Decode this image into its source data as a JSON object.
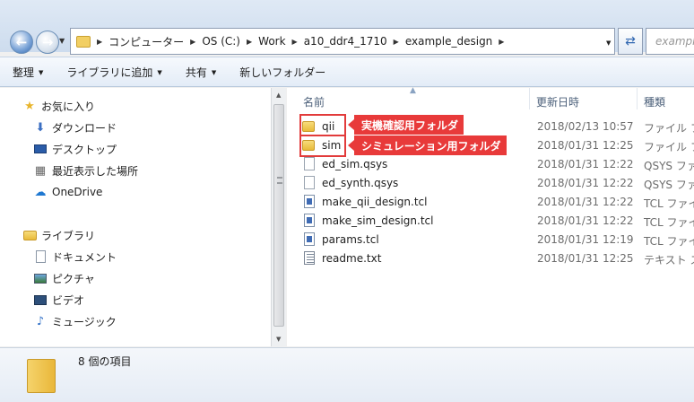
{
  "address": {
    "crumbs": [
      "コンピューター",
      "OS (C:)",
      "Work",
      "a10_ddr4_1710",
      "example_design"
    ],
    "search_placeholder": "example_"
  },
  "toolbar": {
    "organize": "整理",
    "add_library": "ライブラリに追加",
    "share": "共有",
    "new_folder": "新しいフォルダー"
  },
  "nav": {
    "favorites": "お気に入り",
    "downloads": "ダウンロード",
    "desktop": "デスクトップ",
    "recent": "最近表示した場所",
    "onedrive": "OneDrive",
    "libraries": "ライブラリ",
    "documents": "ドキュメント",
    "pictures": "ピクチャ",
    "videos": "ビデオ",
    "music": "ミュージック"
  },
  "columns": {
    "name": "名前",
    "date": "更新日時",
    "type": "種類"
  },
  "files": [
    {
      "name": "qii",
      "date": "2018/02/13 10:57",
      "type": "ファイル フ",
      "icon": "folder-icon"
    },
    {
      "name": "sim",
      "date": "2018/01/31 12:25",
      "type": "ファイル フ",
      "icon": "folder-icon"
    },
    {
      "name": "ed_sim.qsys",
      "date": "2018/01/31 12:22",
      "type": "QSYS ファ",
      "icon": "file-icon"
    },
    {
      "name": "ed_synth.qsys",
      "date": "2018/01/31 12:22",
      "type": "QSYS ファ",
      "icon": "file-icon"
    },
    {
      "name": "make_qii_design.tcl",
      "date": "2018/01/31 12:22",
      "type": "TCL ファイ",
      "icon": "tcl-file-icon"
    },
    {
      "name": "make_sim_design.tcl",
      "date": "2018/01/31 12:22",
      "type": "TCL ファイ",
      "icon": "tcl-file-icon"
    },
    {
      "name": "params.tcl",
      "date": "2018/01/31 12:19",
      "type": "TCL ファイ",
      "icon": "tcl-file-icon"
    },
    {
      "name": "readme.txt",
      "date": "2018/01/31 12:25",
      "type": "テキスト ス",
      "icon": "text-file-icon"
    }
  ],
  "annotations": {
    "qii_label": "実機確認用フォルダ",
    "sim_label": "シミュレーション用フォルダ",
    "color": "#e83a3a"
  },
  "status": {
    "count_text": "8 個の項目"
  }
}
